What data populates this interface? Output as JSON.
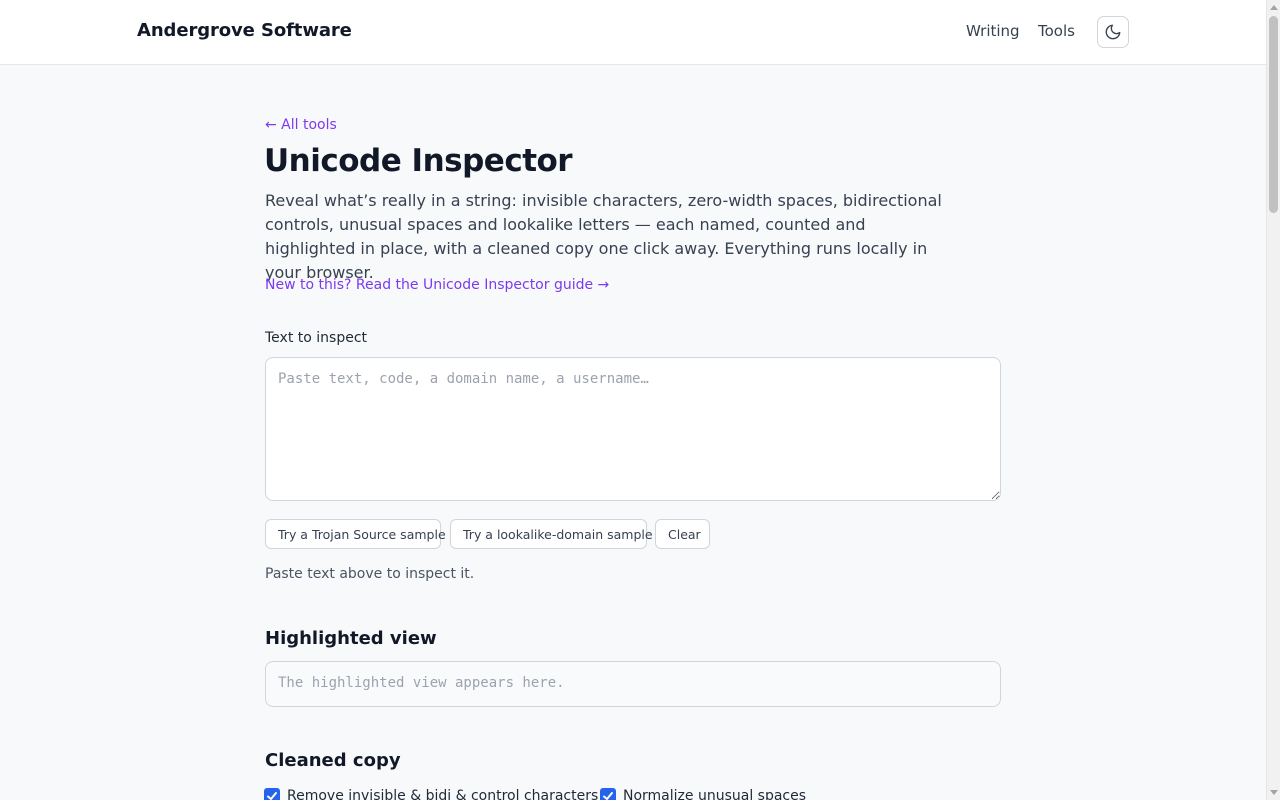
{
  "header": {
    "brand": "Andergrove Software",
    "nav": [
      {
        "label": "Writing"
      },
      {
        "label": "Tools"
      }
    ],
    "theme_icon": "moon-icon"
  },
  "main": {
    "back_link": "← All tools",
    "title": "Unicode Inspector",
    "intro": "Reveal what’s really in a string: invisible characters, zero-width spaces, bidirectional controls, unusual spaces and lookalike letters — each named, counted and highlighted in place, with a cleaned copy one click away. Everything runs locally in your browser.",
    "guide_link": "New to this? Read the Unicode Inspector guide →",
    "input": {
      "label": "Text to inspect",
      "value": "",
      "placeholder": "Paste text, code, a domain name, a username…"
    },
    "buttons": {
      "trojan": "Try a Trojan Source sample",
      "lookalike": "Try a lookalike-domain sample",
      "clear": "Clear"
    },
    "status": "Paste text above to inspect it.",
    "highlighted": {
      "heading": "Highlighted view",
      "placeholder": "The highlighted view appears here."
    },
    "cleaned": {
      "heading": "Cleaned copy",
      "options": [
        {
          "label": "Remove invisible & bidi & control characters",
          "checked": true
        },
        {
          "label": "Normalize unusual spaces",
          "checked": true
        }
      ]
    }
  },
  "colors": {
    "accent": "#7c3aed",
    "checkbox": "#2563eb"
  }
}
